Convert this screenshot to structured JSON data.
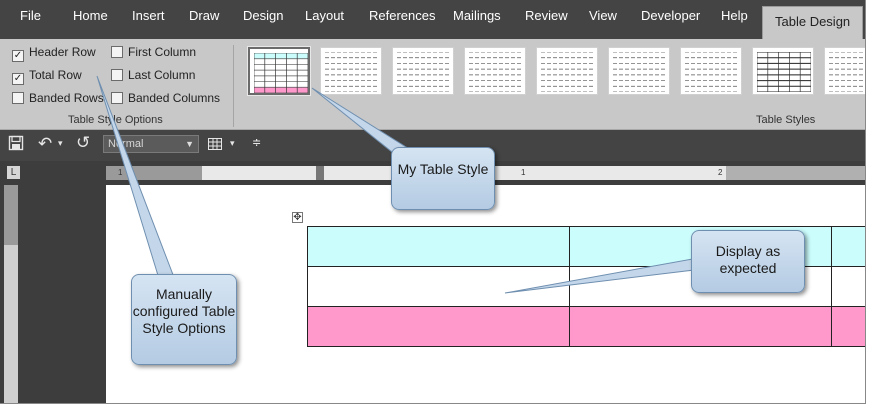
{
  "ribbon": {
    "tabs": [
      {
        "label": "File",
        "active": false
      },
      {
        "label": "Home",
        "active": false
      },
      {
        "label": "Insert",
        "active": false
      },
      {
        "label": "Draw",
        "active": false
      },
      {
        "label": "Design",
        "active": false
      },
      {
        "label": "Layout",
        "active": false
      },
      {
        "label": "References",
        "active": false
      },
      {
        "label": "Mailings",
        "active": false
      },
      {
        "label": "Review",
        "active": false
      },
      {
        "label": "View",
        "active": false
      },
      {
        "label": "Developer",
        "active": false
      },
      {
        "label": "Help",
        "active": false
      },
      {
        "label": "Table Design",
        "active": true
      }
    ],
    "style_options": {
      "header_row": {
        "label": "Header Row",
        "checked": true
      },
      "total_row": {
        "label": "Total Row",
        "checked": true
      },
      "banded_rows": {
        "label": "Banded Rows",
        "checked": false
      },
      "first_column": {
        "label": "First Column",
        "checked": false
      },
      "last_column": {
        "label": "Last Column",
        "checked": false
      },
      "banded_columns": {
        "label": "Banded Columns",
        "checked": false
      },
      "group_label": "Table Style Options"
    },
    "table_styles": {
      "group_label": "Table Styles",
      "count": 9,
      "selected_index": 0
    },
    "check_glyph": "✓"
  },
  "qat": {
    "style_value": "Normal",
    "icons": [
      "save-icon",
      "undo-icon",
      "redo-icon",
      "table-icon",
      "customize-icon"
    ]
  },
  "ruler": {
    "marks": [
      "1",
      "1",
      "2"
    ]
  },
  "callouts": {
    "my_table_style": "My Table Style",
    "manually_configured": "Manually configured Table Style Options",
    "display_as_expected": "Display as expected"
  },
  "document": {
    "table_row_kinds": [
      "header",
      "body",
      "total"
    ],
    "header_color": "#ccfdfd",
    "total_color": "#ff99cc"
  },
  "colors": {
    "ribbon_tabs_bg": "#444444",
    "ribbon_bg": "#c8c8c8",
    "callout_fill": "#c4d7ea"
  }
}
